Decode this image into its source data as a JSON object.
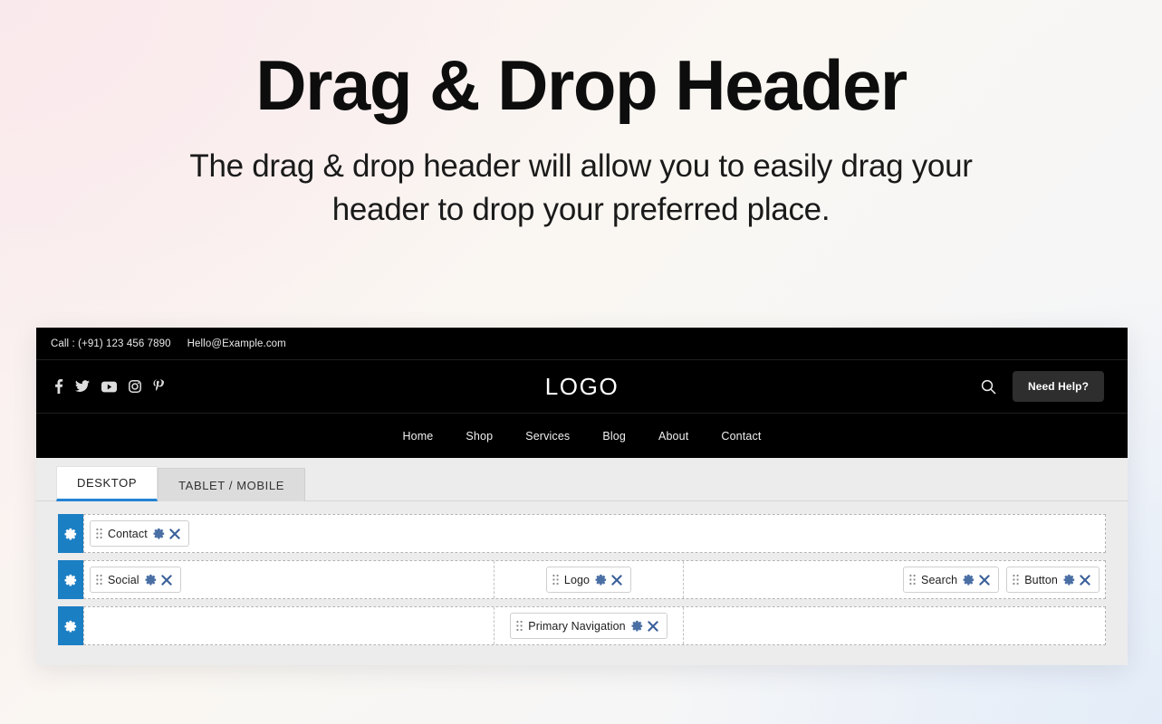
{
  "hero": {
    "title": "Drag & Drop Header",
    "subtitle": "The drag & drop header will allow you to easily drag your header to drop your preferred place."
  },
  "preview": {
    "top_bar": {
      "phone": "Call : (+91) 123 456 7890",
      "email": "Hello@Example.com"
    },
    "social": [
      {
        "name": "facebook-icon"
      },
      {
        "name": "twitter-icon"
      },
      {
        "name": "youtube-icon"
      },
      {
        "name": "instagram-icon"
      },
      {
        "name": "pinterest-icon"
      }
    ],
    "logo": "LOGO",
    "search_icon": "search-icon",
    "help_button": "Need Help?",
    "nav": [
      "Home",
      "Shop",
      "Services",
      "Blog",
      "About",
      "Contact"
    ]
  },
  "device_tabs": [
    {
      "label": "DESKTOP",
      "active": true
    },
    {
      "label": "TABLET / MOBILE",
      "active": false
    }
  ],
  "builder_rows": [
    {
      "handle_icon": "gear-icon",
      "columns": [
        {
          "widgets": [
            {
              "label": "Contact"
            }
          ]
        }
      ]
    },
    {
      "handle_icon": "gear-icon",
      "columns": [
        {
          "widgets": [
            {
              "label": "Social"
            }
          ]
        },
        {
          "widgets": [
            {
              "label": "Logo"
            }
          ]
        },
        {
          "widgets": [
            {
              "label": "Search"
            },
            {
              "label": "Button"
            }
          ]
        }
      ]
    },
    {
      "handle_icon": "gear-icon",
      "columns": [
        {
          "widgets": []
        },
        {
          "widgets": [
            {
              "label": "Primary Navigation"
            }
          ]
        },
        {
          "widgets": []
        }
      ]
    }
  ],
  "colors": {
    "accent_blue": "#1b7fc4",
    "tab_underline": "#2483d4",
    "preview_bg": "#000000",
    "canvas_bg": "#ececec"
  }
}
